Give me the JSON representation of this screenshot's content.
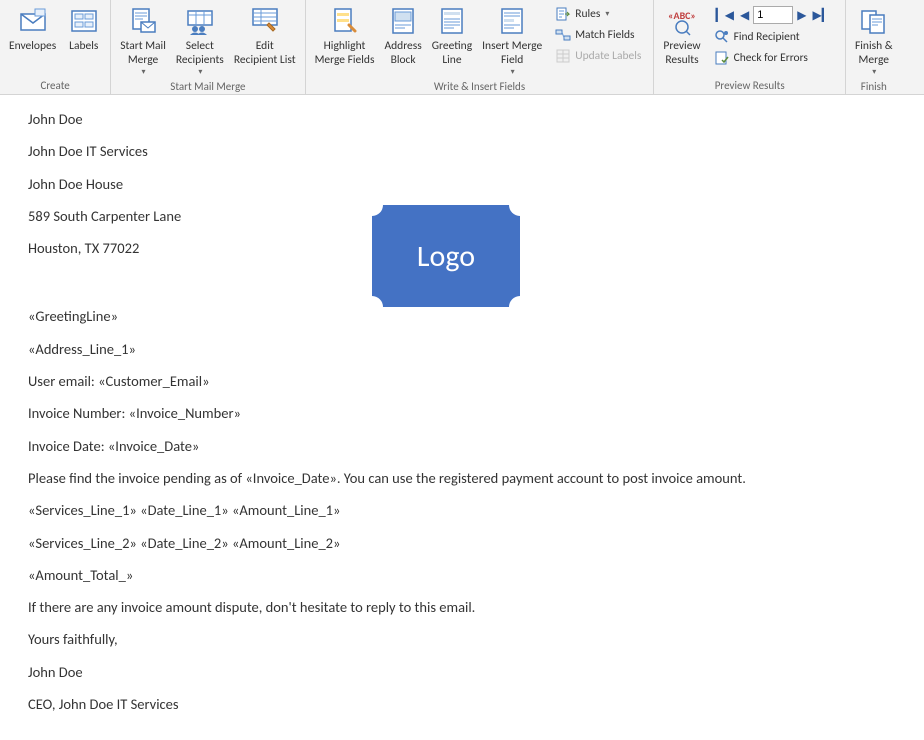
{
  "ribbon": {
    "groups": {
      "create": {
        "label": "Create",
        "envelopes": "Envelopes",
        "labels": "Labels"
      },
      "start_mail_merge": {
        "label": "Start Mail Merge",
        "start_mail_merge": "Start Mail\nMerge",
        "select_recipients": "Select\nRecipients",
        "edit_recipient_list": "Edit\nRecipient List"
      },
      "write_insert": {
        "label": "Write & Insert Fields",
        "highlight_merge_fields": "Highlight\nMerge Fields",
        "address_block": "Address\nBlock",
        "greeting_line": "Greeting\nLine",
        "insert_merge_field": "Insert Merge\nField",
        "rules": "Rules",
        "match_fields": "Match Fields",
        "update_labels": "Update Labels"
      },
      "preview_results": {
        "label": "Preview Results",
        "preview_results": "Preview\nResults",
        "record_number": "1",
        "find_recipient": "Find Recipient",
        "check_for_errors": "Check for Errors"
      },
      "finish": {
        "label": "Finish",
        "finish_merge": "Finish &\nMerge"
      }
    }
  },
  "document": {
    "sender": {
      "name": "John Doe",
      "company": "John Doe IT Services",
      "building": "John Doe House",
      "street": "589 South Carpenter Lane",
      "city_state_zip": "Houston, TX 77022"
    },
    "logo_text": "Logo",
    "fields": {
      "greeting_line": "«GreetingLine»",
      "address_line_1": "«Address_Line_1»",
      "user_email_label": "User email: ",
      "customer_email": "«Customer_Email»",
      "invoice_number_label": "Invoice Number: ",
      "invoice_number": "«Invoice_Number»",
      "invoice_date_label": "Invoice Date: ",
      "invoice_date": "«Invoice_Date»",
      "intro": "Please find the invoice pending as of «Invoice_Date». You can use the registered payment account to post invoice amount.",
      "line1": "«Services_Line_1» «Date_Line_1» «Amount_Line_1»",
      "line2": "«Services_Line_2» «Date_Line_2» «Amount_Line_2»",
      "amount_total": "«Amount_Total_»",
      "dispute": "If there are any invoice amount dispute, don't hesitate to reply to this email.",
      "closing": "Yours faithfully,",
      "signature_name": "John Doe",
      "signature_title": "CEO, John Doe IT Services"
    }
  }
}
